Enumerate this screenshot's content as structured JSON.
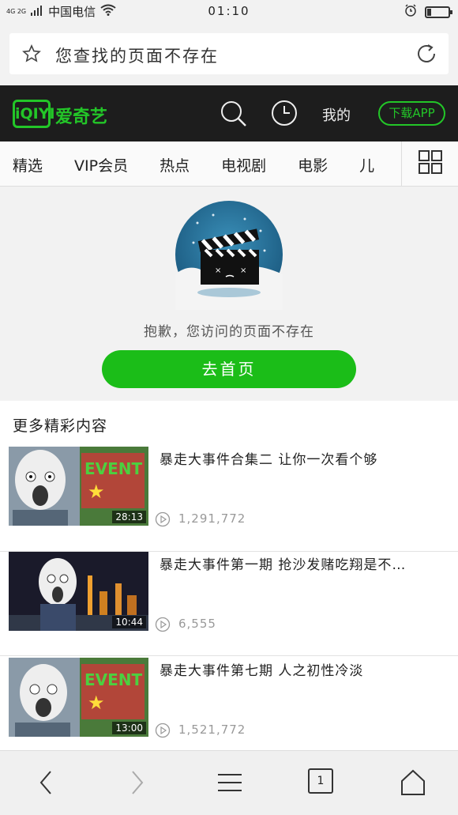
{
  "status_bar": {
    "network": "4G 2G",
    "carrier": "中国电信",
    "time": "01:10",
    "battery_level": 0.2
  },
  "address_bar": {
    "url_text": "您查找的页面不存在"
  },
  "iqiyi_header": {
    "logo": "iQIYI",
    "brand_name": "爱奇艺",
    "mine_label": "我的",
    "download_label": "下载APP",
    "brand_color": "#23c628"
  },
  "category_nav": {
    "items": [
      "精选",
      "VIP会员",
      "热点",
      "电视剧",
      "电影",
      "儿"
    ]
  },
  "error": {
    "message": "抱歉，您访问的页面不存在",
    "home_button": "去首页"
  },
  "more": {
    "title": "更多精彩内容",
    "videos": [
      {
        "title": "暴走大事件合集二 让你一次看个够",
        "duration": "28:13",
        "views": "1,291,772"
      },
      {
        "title": "暴走大事件第一期 抢沙发赌吃翔是不…",
        "duration": "10:44",
        "views": "6,555"
      },
      {
        "title": "暴走大事件第七期 人之初性冷淡",
        "duration": "13:00",
        "views": "1,521,772"
      }
    ]
  },
  "bottom_bar": {
    "tab_count": "1"
  }
}
